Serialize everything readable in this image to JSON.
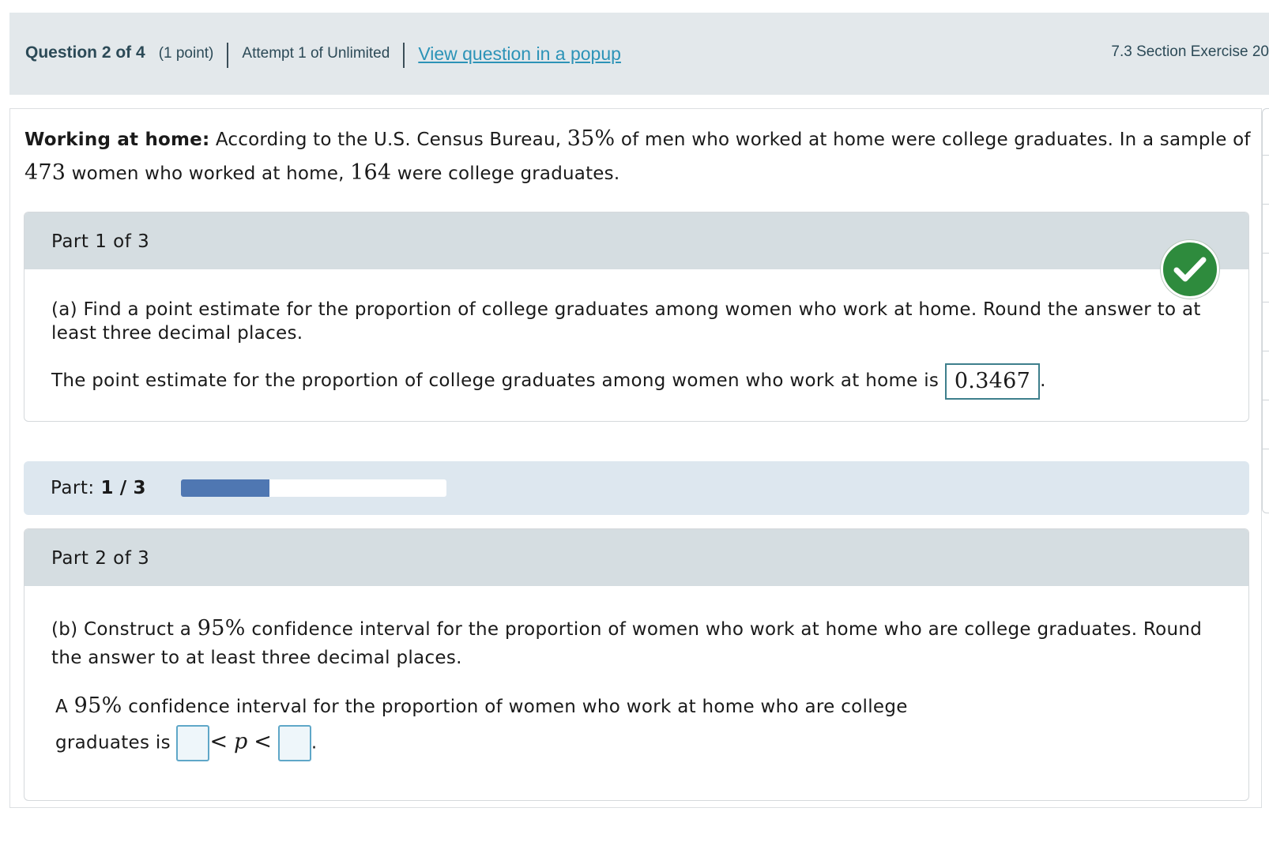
{
  "header": {
    "question": "Question 2 of 4",
    "points": "(1 point)",
    "attempt": "Attempt 1 of Unlimited",
    "popup_link": "View question in a popup",
    "section": "7.3 Section Exercise 20"
  },
  "intro": {
    "bold_label": "Working at home:",
    "text_1": "According to the U.S. Census Bureau,",
    "pct": "35%",
    "text_2": "of men who worked at home were college graduates. In a sample of",
    "n": "473",
    "text_3": "women who worked at home,",
    "x": "164",
    "text_4": "were college graduates."
  },
  "part1": {
    "title": "Part 1 of 3",
    "question": "(a) Find a point estimate for the proportion of college graduates among women who work at home. Round the answer to at least three decimal places.",
    "answer_prefix": "The point estimate for the proportion of college graduates among women who work at home is",
    "answer_value": "0.3467",
    "answer_suffix": ".",
    "status_icon": "checkmark-icon",
    "status_color": "#2e8b3d"
  },
  "progress": {
    "label": "Part:",
    "current": "1",
    "sep": "/",
    "total": "3",
    "fraction": 0.333,
    "fill_color": "#4f77b2"
  },
  "part2": {
    "title": "Part 2 of 3",
    "q_prefix": "(b) Construct a",
    "q_pct": "95%",
    "q_suffix": "confidence interval for the proportion of women who work at home who are college graduates. Round the answer to at least three decimal places.",
    "a_prefix": "A",
    "a_pct": "95%",
    "a_mid": "confidence interval for the proportion of women who work at home who are college",
    "a_line2": "graduates is",
    "lt1": "<",
    "var": "p",
    "lt2": "<",
    "lower_value": "",
    "upper_value": "",
    "end": "."
  }
}
